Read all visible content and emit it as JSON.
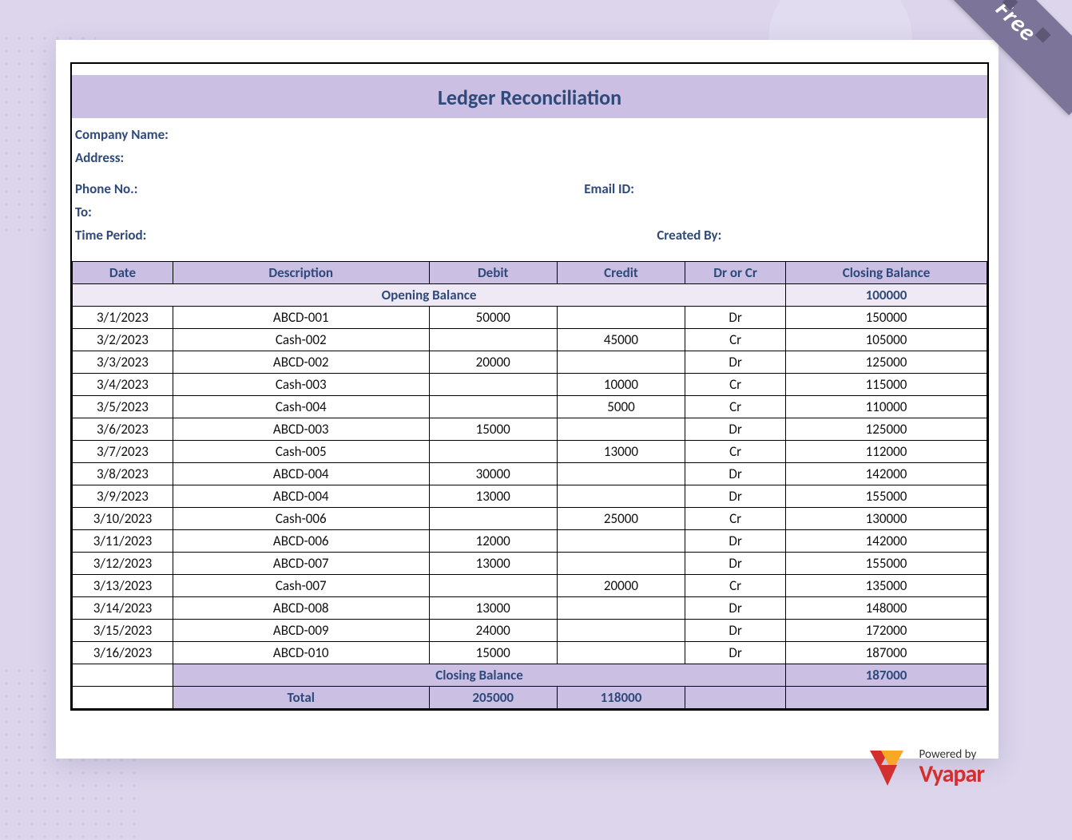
{
  "ribbon": {
    "label": "Free"
  },
  "title": "Ledger Reconciliation",
  "info": {
    "company_label": "Company Name:",
    "address_label": "Address:",
    "phone_label": "Phone No.:",
    "email_label": "Email ID:",
    "to_label": "To:",
    "period_label": "Time Period:",
    "created_by_label": "Created By:"
  },
  "columns": {
    "date": "Date",
    "description": "Description",
    "debit": "Debit",
    "credit": "Credit",
    "drcr": "Dr or Cr",
    "closing": "Closing Balance"
  },
  "opening": {
    "label": "Opening Balance",
    "value": "100000"
  },
  "rows": [
    {
      "date": "3/1/2023",
      "desc": "ABCD-001",
      "debit": "50000",
      "credit": "",
      "drcr": "Dr",
      "closing": "150000"
    },
    {
      "date": "3/2/2023",
      "desc": "Cash-002",
      "debit": "",
      "credit": "45000",
      "drcr": "Cr",
      "closing": "105000"
    },
    {
      "date": "3/3/2023",
      "desc": "ABCD-002",
      "debit": "20000",
      "credit": "",
      "drcr": "Dr",
      "closing": "125000"
    },
    {
      "date": "3/4/2023",
      "desc": "Cash-003",
      "debit": "",
      "credit": "10000",
      "drcr": "Cr",
      "closing": "115000"
    },
    {
      "date": "3/5/2023",
      "desc": "Cash-004",
      "debit": "",
      "credit": "5000",
      "drcr": "Cr",
      "closing": "110000"
    },
    {
      "date": "3/6/2023",
      "desc": "ABCD-003",
      "debit": "15000",
      "credit": "",
      "drcr": "Dr",
      "closing": "125000"
    },
    {
      "date": "3/7/2023",
      "desc": "Cash-005",
      "debit": "",
      "credit": "13000",
      "drcr": "Cr",
      "closing": "112000"
    },
    {
      "date": "3/8/2023",
      "desc": "ABCD-004",
      "debit": "30000",
      "credit": "",
      "drcr": "Dr",
      "closing": "142000"
    },
    {
      "date": "3/9/2023",
      "desc": "ABCD-004",
      "debit": "13000",
      "credit": "",
      "drcr": "Dr",
      "closing": "155000"
    },
    {
      "date": "3/10/2023",
      "desc": "Cash-006",
      "debit": "",
      "credit": "25000",
      "drcr": "Cr",
      "closing": "130000"
    },
    {
      "date": "3/11/2023",
      "desc": "ABCD-006",
      "debit": "12000",
      "credit": "",
      "drcr": "Dr",
      "closing": "142000"
    },
    {
      "date": "3/12/2023",
      "desc": "ABCD-007",
      "debit": "13000",
      "credit": "",
      "drcr": "Dr",
      "closing": "155000"
    },
    {
      "date": "3/13/2023",
      "desc": "Cash-007",
      "debit": "",
      "credit": "20000",
      "drcr": "Cr",
      "closing": "135000"
    },
    {
      "date": "3/14/2023",
      "desc": "ABCD-008",
      "debit": "13000",
      "credit": "",
      "drcr": "Dr",
      "closing": "148000"
    },
    {
      "date": "3/15/2023",
      "desc": "ABCD-009",
      "debit": "24000",
      "credit": "",
      "drcr": "Dr",
      "closing": "172000"
    },
    {
      "date": "3/16/2023",
      "desc": "ABCD-010",
      "debit": "15000",
      "credit": "",
      "drcr": "Dr",
      "closing": "187000"
    }
  ],
  "closing": {
    "label": "Closing Balance",
    "value": "187000"
  },
  "total": {
    "label": "Total",
    "debit": "205000",
    "credit": "118000"
  },
  "footer": {
    "powered": "Powered by",
    "brand": "Vyapar"
  }
}
